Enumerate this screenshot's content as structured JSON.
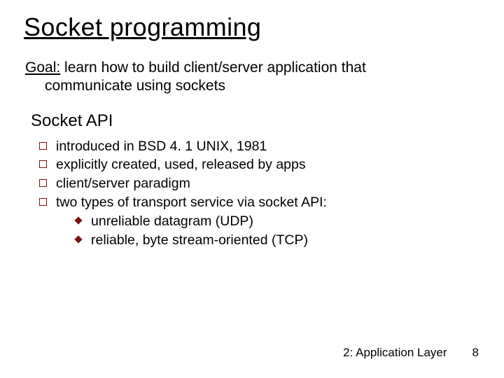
{
  "title": "Socket programming",
  "goal": {
    "label": "Goal:",
    "line1": " learn how to build client/server application that",
    "line2": "communicate using sockets"
  },
  "subhead": "Socket API",
  "bullets": [
    "introduced in BSD 4. 1 UNIX, 1981",
    "explicitly created, used, released by apps",
    "client/server paradigm",
    "two types of transport service via socket API:"
  ],
  "subbullets": [
    "unreliable datagram (UDP)",
    "reliable, byte stream-oriented (TCP)"
  ],
  "footer": {
    "section": "2: Application Layer",
    "page": "8"
  }
}
